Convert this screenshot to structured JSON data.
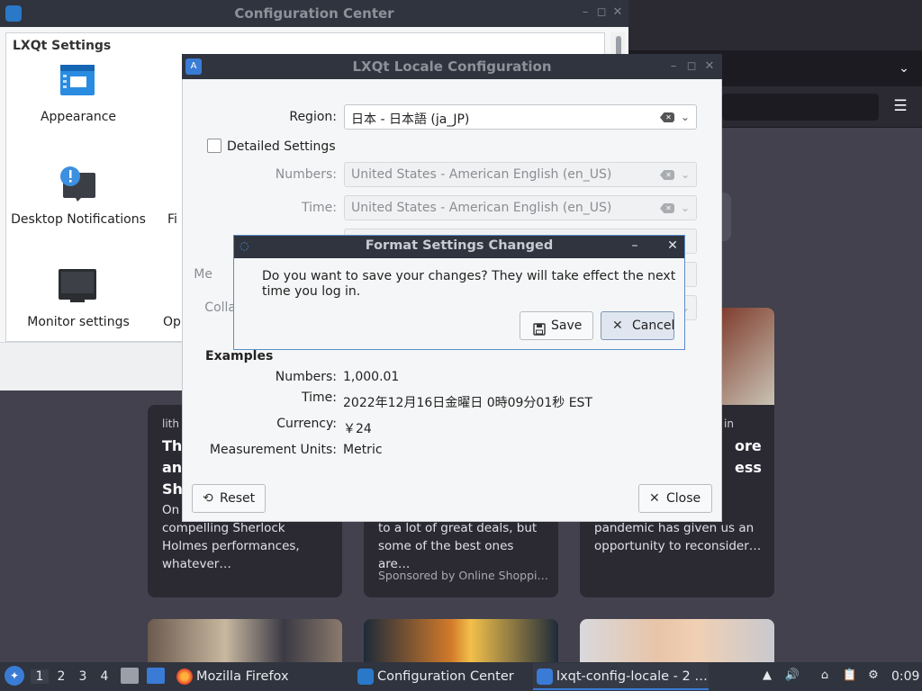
{
  "config_center": {
    "title": "Configuration Center",
    "section": "LXQt Settings",
    "items": [
      {
        "label": "Appearance"
      },
      {
        "label": "Desktop Notifications"
      },
      {
        "label": "Monitor settings"
      }
    ],
    "partial_items": [
      "Fi",
      "Op"
    ]
  },
  "locale_window": {
    "title": "LXQt Locale Configuration",
    "region_label": "Region:",
    "region_value": "日本 - 日本語 (ja_JP)",
    "detailed_label": "Detailed Settings",
    "numbers_label": "Numbers:",
    "numbers_value": "United States - American English (en_US)",
    "time_label": "Time:",
    "time_value": "United States - American English (en_US)",
    "partial_labels": [
      "Me",
      "Colla"
    ],
    "examples_title": "Examples",
    "examples": {
      "numbers_label": "Numbers:",
      "numbers_value": "1,000.01",
      "time_label": "Time:",
      "time_value": "2022年12月16日金曜日 0時09分01秒 EST",
      "currency_label": "Currency:",
      "currency_value": "￥24",
      "units_label": "Measurement Units:",
      "units_value": "Metric"
    },
    "reset_label": "Reset",
    "close_label": "Close"
  },
  "dialog": {
    "title": "Format Settings Changed",
    "message": "Do you want to save your changes? They will take effect the next time you log in.",
    "save_label": "Save",
    "cancel_label": "Cancel"
  },
  "firefox": {
    "cards": [
      {
        "source": "lith",
        "title_lines": [
          "Th",
          "an",
          "Sh"
        ],
        "excerpt": "On compelling Sherlock Holmes performances, whatever…",
        "excerpt_first": "On",
        "excerpt_rest": "compelling Sherlock Holmes performances, whatever…"
      },
      {
        "excerpt": "to a lot of great deals, but some of the best ones are…",
        "sponsor": "Sponsored by Online Shoppi…"
      },
      {
        "source": "in",
        "title_lines": [
          "ore",
          "ess"
        ],
        "excerpt": "pandemic has given us an opportunity to reconsider…"
      }
    ]
  },
  "taskbar": {
    "workspaces": [
      "1",
      "2",
      "3",
      "4"
    ],
    "tasks": [
      {
        "label": "Mozilla Firefox"
      },
      {
        "label": "Configuration Center"
      },
      {
        "label": "lxqt-config-locale - 2 …"
      }
    ],
    "clock": "0:09"
  }
}
